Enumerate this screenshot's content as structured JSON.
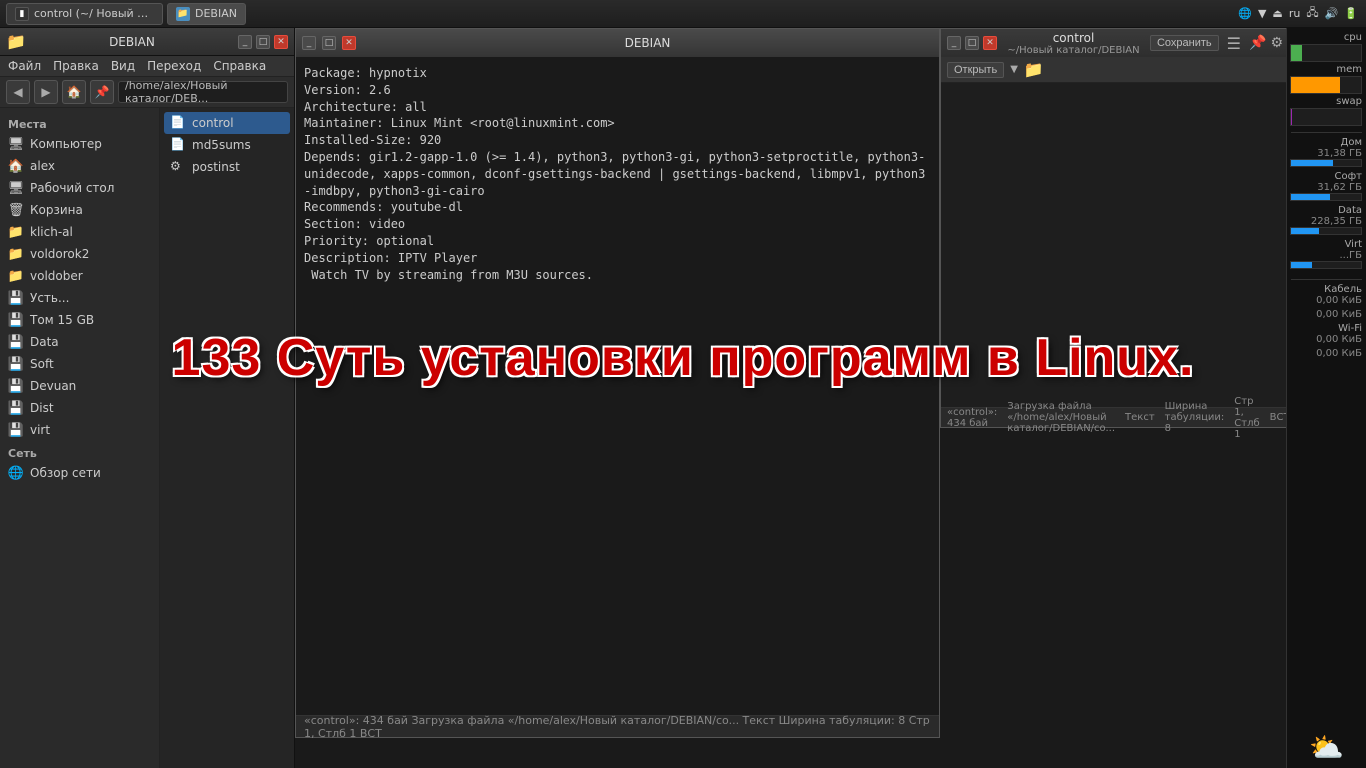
{
  "taskbar": {
    "apps": [
      {
        "id": "control-tab",
        "label": "control (~/ Новый ката...",
        "type": "terminal",
        "active": false
      },
      {
        "id": "debian-tab",
        "label": "DEBIAN",
        "type": "folder",
        "active": true
      }
    ],
    "right_icons": [
      "🌐",
      "▼",
      "⏏",
      "ru",
      "🔊",
      "🔋"
    ]
  },
  "file_manager": {
    "title": "DEBIAN",
    "title_icon": "📁",
    "menu_items": [
      "Файл",
      "Правка",
      "Вид",
      "Переход",
      "Справка"
    ],
    "path": "/home/alex/Новый каталог/DEB...",
    "sidebar_sections": [
      {
        "label": "Места",
        "items": [
          {
            "icon": "🖥",
            "label": "Компьютер"
          },
          {
            "icon": "🏠",
            "label": "alex"
          },
          {
            "icon": "🖥",
            "label": "Рабочий стол"
          },
          {
            "icon": "🗑",
            "label": "Корзина"
          },
          {
            "icon": "📁",
            "label": "klich-al"
          },
          {
            "icon": "📁",
            "label": "voldorok2"
          },
          {
            "icon": "📁",
            "label": "voldober"
          },
          {
            "icon": "💾",
            "label": "Усть..."
          },
          {
            "icon": "💾",
            "label": "Том 15 GB"
          },
          {
            "icon": "💾",
            "label": "Data"
          },
          {
            "icon": "💾",
            "label": "Soft"
          },
          {
            "icon": "💾",
            "label": "Devuan"
          },
          {
            "icon": "💾",
            "label": "Dist"
          },
          {
            "icon": "💾",
            "label": "virt"
          }
        ]
      },
      {
        "label": "Сеть",
        "items": [
          {
            "icon": "🌐",
            "label": "Обзор сети"
          }
        ]
      }
    ],
    "files": [
      {
        "name": "control",
        "selected": true
      },
      {
        "name": "md5sums",
        "selected": false
      },
      {
        "name": "postinst",
        "selected": false
      }
    ]
  },
  "terminal": {
    "title": "DEBIAN",
    "lines": [
      "Package: hypnotix",
      "Version: 2.6",
      "Architecture: all",
      "Maintainer: Linux Mint <root@linuxmint.com>",
      "Installed-Size: 920",
      "Depends: gir1.2-gapp-1.0 (>= 1.4), python3, python3-gi, python3-setproctitle, python3-unidecode, xapps-common, dconf-gsettings-backend | gsettings-backend, libmpv1, python3-imdbpy, python3-gi-cairo",
      "Recommends: youtube-dl",
      "Section: video",
      "Priority: optional",
      "Description: IPTV Player",
      " Watch TV by streaming from M3U sources."
    ],
    "status": "«control»: 434 бай    Загрузка файла «/home/alex/Новый каталог/DEBIAN/co...    Текст    Ширина табуляции: 8    Стр 1, Стлб 1    ВСТ"
  },
  "text_editor": {
    "title_line1": "control",
    "title_line2": "~/Новый каталог/DEBIAN",
    "toolbar_items": [
      "Открыть",
      "▼",
      "📁"
    ],
    "save_label": "Сохранить",
    "status_items": [
      "«control»: 434 бай",
      "Загрузка файла «/home/alex/Новый каталог/DEBIAN/co...",
      "Текст",
      "Ширина табуляции: 8",
      "Стр 1, Стлб 1",
      "ВСТ"
    ]
  },
  "sysmon": {
    "cpu": {
      "label": "cpu",
      "percent": 15
    },
    "mem": {
      "label": "mem",
      "percent": 70
    },
    "swap": {
      "label": "swap",
      "percent": 2
    },
    "disks": [
      {
        "label": "Дом",
        "size": "31,38 ГБ",
        "percent": 60
      },
      {
        "label": "Софт",
        "size": "31,62 ГБ",
        "percent": 55
      },
      {
        "label": "Data",
        "size": "228,35 ГБ",
        "percent": 40
      },
      {
        "label": "Virt",
        "size": "...ГБ",
        "percent": 30
      }
    ],
    "network": [
      {
        "label": "Кабель",
        "value": "0,00 КиБ"
      },
      {
        "label": "",
        "value": "0,00 КиБ"
      },
      {
        "label": "Wi-Fi",
        "value": "0,00 КиБ"
      },
      {
        "label": "",
        "value": "0,00 КиБ"
      }
    ]
  },
  "overlay": {
    "text": "133 Суть установки программ в Linux."
  }
}
